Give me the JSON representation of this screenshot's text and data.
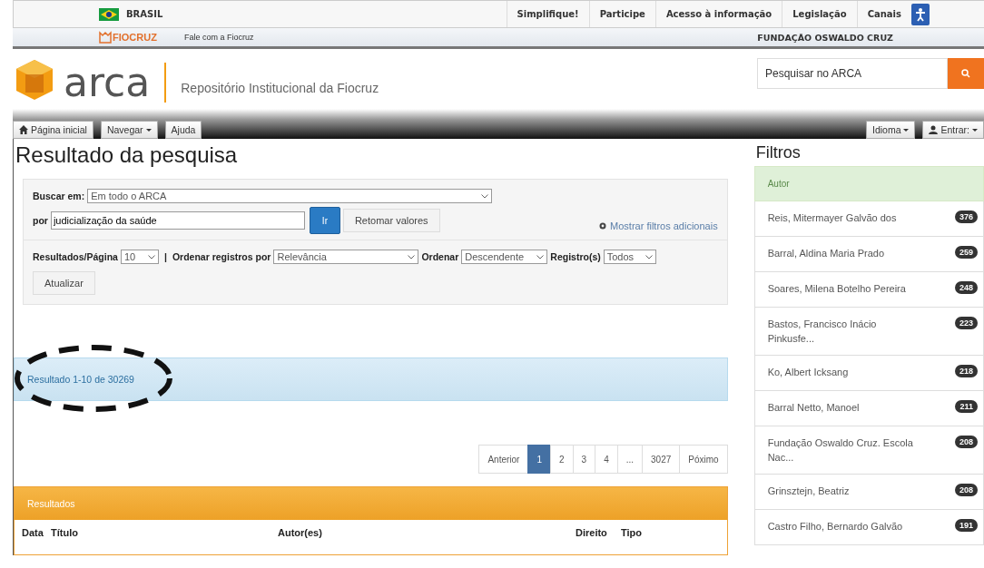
{
  "gov_bar": {
    "country": "BRASIL",
    "links": [
      "Simplifique!",
      "Participe",
      "Acesso à informação",
      "Legislação",
      "Canais"
    ]
  },
  "org_bar": {
    "logo": "FIOCRUZ",
    "contact": "Fale com a Fiocruz",
    "org": "FUNDAÇÃO OSWALDO CRUZ"
  },
  "header": {
    "logo": "arca",
    "subtitle": "Repositório Institucional da Fiocruz",
    "search": {
      "placeholder": "Pesquisar no ARCA"
    }
  },
  "nav": {
    "left": [
      {
        "label": "Página inicial",
        "kind": "home"
      },
      {
        "label": "Navegar",
        "kind": "dropdown"
      },
      {
        "label": "Ajuda",
        "kind": "plain"
      }
    ],
    "right": [
      {
        "label": "Idioma",
        "kind": "dropdown"
      },
      {
        "label": "Entrar:",
        "kind": "user"
      }
    ]
  },
  "page_title": "Resultado da pesquisa",
  "search_form": {
    "scope_label": "Buscar em:",
    "scope_value": "Em todo o ARCA",
    "query_label": "por",
    "query_value": "judicialização da saúde",
    "go_button": "Ir",
    "reset_button": "Retomar valores",
    "more_filters": "Mostrar filtros adicionais"
  },
  "options": [
    {
      "label": "Resultados/Página",
      "value": "10"
    },
    {
      "label": "Ordenar registros por",
      "value": "Relevância"
    },
    {
      "label": "Ordenar",
      "value": "Descendente"
    },
    {
      "label": "Registro(s)",
      "value": "Todos"
    }
  ],
  "options_separator": "|",
  "update_button": "Atualizar",
  "result_summary": {
    "text": "Resultado 1-10 de 30269",
    "highlighted": true
  },
  "pagination": [
    {
      "label": "Anterior",
      "selected": false
    },
    {
      "label": "1",
      "selected": true
    },
    {
      "label": "2",
      "selected": false
    },
    {
      "label": "3",
      "selected": false
    },
    {
      "label": "4",
      "selected": false
    },
    {
      "label": "...",
      "selected": false
    },
    {
      "label": "3027",
      "selected": false
    },
    {
      "label": "Póximo",
      "selected": false
    }
  ],
  "results_panel": {
    "title": "Resultados",
    "columns": [
      "Data",
      "Título",
      "Autor(es)",
      "Direito",
      "Tipo"
    ]
  },
  "filters": {
    "title": "Filtros",
    "section": "Autor",
    "items": [
      {
        "name": "Reis, Mitermayer Galvão dos",
        "count": "376"
      },
      {
        "name": "Barral, Aldina Maria Prado",
        "count": "259"
      },
      {
        "name": "Soares, Milena Botelho Pereira",
        "count": "248"
      },
      {
        "name": "Bastos, Francisco Inácio Pinkusfe...",
        "count": "223"
      },
      {
        "name": "Ko, Albert Icksang",
        "count": "218"
      },
      {
        "name": "Barral Netto, Manoel",
        "count": "211"
      },
      {
        "name": "Fundação Oswaldo Cruz. Escola Nac...",
        "count": "208"
      },
      {
        "name": "Grinsztejn, Beatriz",
        "count": "208"
      },
      {
        "name": "Castro Filho, Bernardo Galvão",
        "count": "191"
      }
    ]
  }
}
